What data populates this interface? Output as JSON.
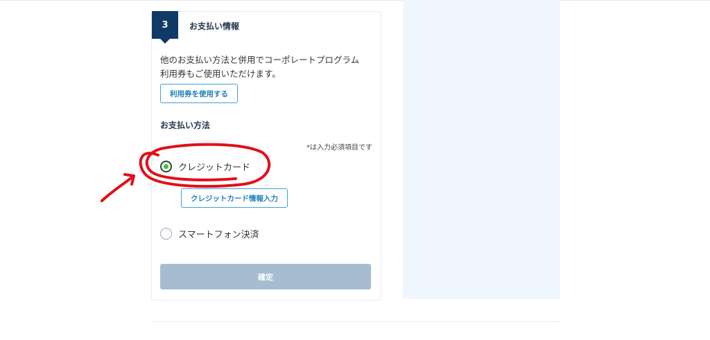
{
  "step": {
    "number": "3",
    "title": "お支払い情報"
  },
  "info": {
    "text_line1": "他のお支払い方法と併用でコーポレートプログラム",
    "text_line2": "利用券もご使用いただけます。",
    "coupon_button": "利用券を使用する"
  },
  "payment": {
    "heading": "お支払い方法",
    "required_note": "*は入力必須項目です",
    "options": [
      {
        "label": "クレジットカード",
        "selected": true
      },
      {
        "label": "スマートフォン決済",
        "selected": false
      }
    ],
    "card_input_button": "クレジットカード情報入力",
    "confirm_button": "確定"
  },
  "colors": {
    "badge": "#0f3a66",
    "link_blue": "#1f7fbf",
    "radio_selected": "#3cc23c",
    "confirm_disabled": "#a6bcd1",
    "side_panel": "#eff6fd",
    "annotation_red": "#e0101a"
  },
  "icons": {
    "annotation_circle": "red-hand-drawn-circle",
    "annotation_arrow": "red-hand-drawn-arrow"
  }
}
